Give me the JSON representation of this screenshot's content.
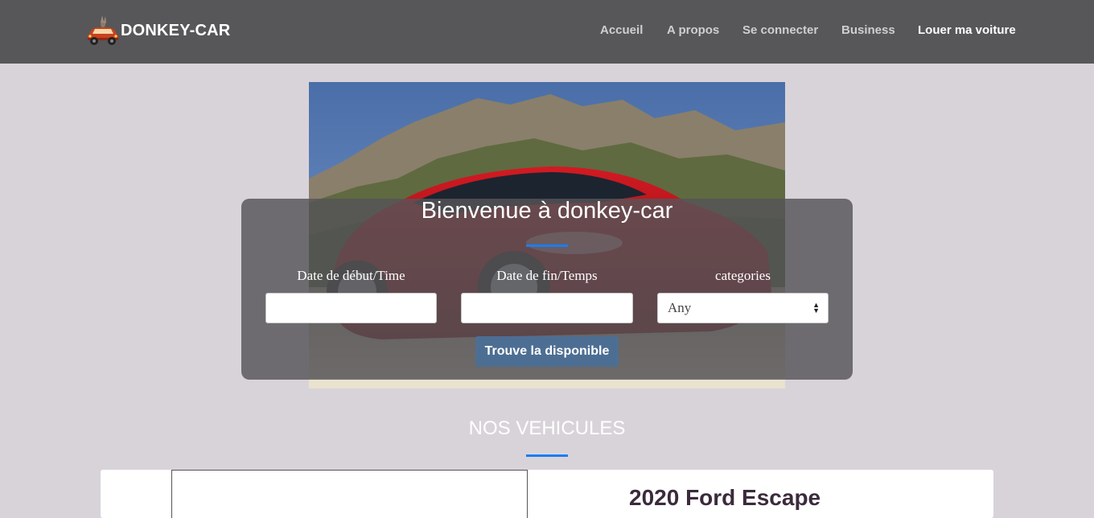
{
  "navbar": {
    "brand": "DONKEY-CAR",
    "links": [
      {
        "label": "Accueil"
      },
      {
        "label": "A propos"
      },
      {
        "label": "Se connecter"
      },
      {
        "label": "Business"
      },
      {
        "label": "Louer ma voiture"
      }
    ]
  },
  "search": {
    "title": "Bienvenue à donkey-car",
    "start_label": "Date de début/Time",
    "end_label": "Date de fin/Temps",
    "category_label": "categories",
    "category_value": "Any",
    "button_label": "Trouve la disponible"
  },
  "vehicles": {
    "section_title": "NOS VEHICULES",
    "first_vehicle_title": "2020 Ford Escape"
  },
  "colors": {
    "navbar_bg": "#575659",
    "page_bg": "#d8d3d9",
    "accent": "#1a7df2",
    "button_bg": "#4d6e93"
  }
}
